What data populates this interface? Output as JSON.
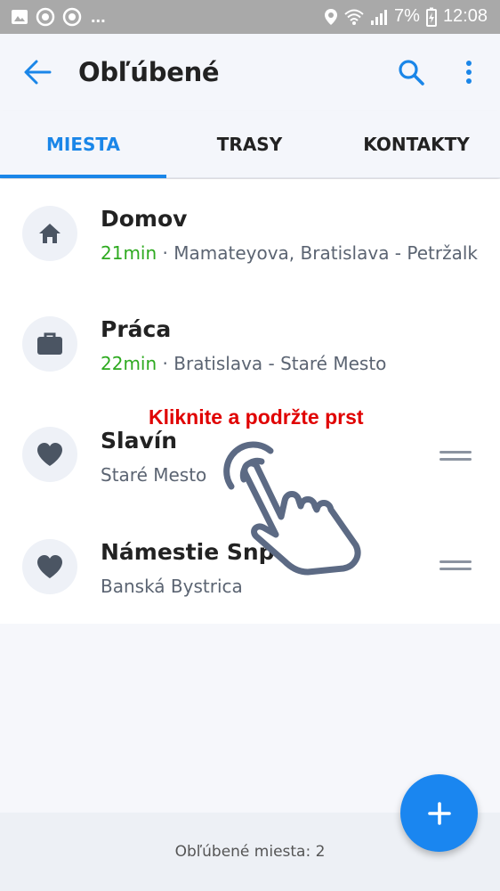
{
  "status_bar": {
    "dots": "...",
    "battery": "7%",
    "time": "12:08"
  },
  "header": {
    "title": "Obľúbené"
  },
  "tabs": [
    {
      "label": "MIESTA",
      "active": true
    },
    {
      "label": "TRASY",
      "active": false
    },
    {
      "label": "KONTAKTY",
      "active": false
    }
  ],
  "places": [
    {
      "name": "Domov",
      "icon": "home-icon",
      "time": "21min",
      "separator": " · ",
      "address": "Mamateyova, Bratislava - Petržalka",
      "draggable": false
    },
    {
      "name": "Práca",
      "icon": "briefcase-icon",
      "time": "22min",
      "separator": " · ",
      "address": "Bratislava - Staré Mesto",
      "draggable": false
    },
    {
      "name": "Slavín",
      "icon": "heart-icon",
      "address": "Staré Mesto",
      "draggable": true
    },
    {
      "name": "Námestie Snp",
      "icon": "heart-icon",
      "address": "Banská Bystrica",
      "draggable": true
    }
  ],
  "hint": {
    "text": "Kliknite a podržte prst"
  },
  "footer": {
    "text": "Obľúbené miesta: 2"
  },
  "colors": {
    "accent": "#1a86e8",
    "time_green": "#2eaa20",
    "hint_red": "#e00000",
    "icon_gray": "#4b5563"
  }
}
